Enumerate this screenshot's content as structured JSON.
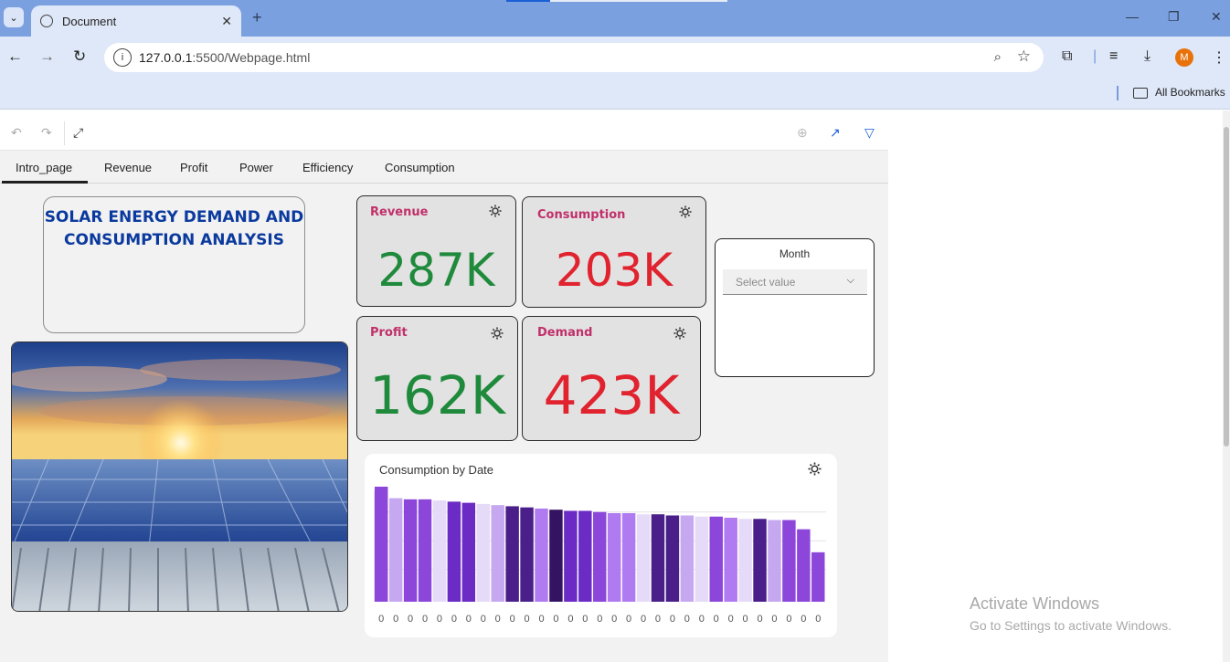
{
  "browser": {
    "tab_title": "Document",
    "url_host": "127.0.0.1",
    "url_rest": ":5500/Webpage.html",
    "bookmarks_label": "All Bookmarks",
    "avatar_initial": "M"
  },
  "report": {
    "tabs": [
      "Intro_page",
      "Revenue",
      "Profit",
      "Power",
      "Efficiency",
      "Consumption"
    ],
    "active_tab": "Intro_page",
    "title_line1": "SOLAR ENERGY DEMAND AND",
    "title_line2": "CONSUMPTION  ANALYSIS"
  },
  "kpis": {
    "revenue": {
      "label": "Revenue",
      "value": "287K",
      "color": "#1f8a3c"
    },
    "consumption": {
      "label": "Consumption",
      "value": "203K",
      "color": "#e0232e"
    },
    "profit": {
      "label": "Profit",
      "value": "162K",
      "color": "#1f8a3c"
    },
    "demand": {
      "label": "Demand",
      "value": "423K",
      "color": "#e0232e"
    }
  },
  "slicer": {
    "title": "Month",
    "placeholder": "Select value"
  },
  "chart_data": {
    "type": "bar",
    "title": "Consumption  by Date",
    "tick_label": "0",
    "values": [
      100,
      90,
      89,
      89,
      88,
      87,
      86,
      85,
      84,
      83,
      82,
      81,
      80,
      79,
      79,
      78,
      77,
      77,
      76,
      76,
      75,
      75,
      74,
      74,
      73,
      72,
      72,
      71,
      71,
      63,
      43
    ],
    "ylim": [
      0,
      100
    ],
    "colors": [
      "#8c46d9",
      "#c6a8f0",
      "#8c46d9",
      "#8c46d9",
      "#e5daf7",
      "#6b2bc4",
      "#6b2bc4",
      "#e5daf7",
      "#c6a8f0",
      "#4a1f8a",
      "#4a1f8a",
      "#b07af0",
      "#341462",
      "#6b2bc4",
      "#6b2bc4",
      "#8c46d9",
      "#b07af0",
      "#b07af0",
      "#e5daf7",
      "#4a1f8a",
      "#4a1f8a",
      "#c6a8f0",
      "#e5daf7",
      "#8c46d9",
      "#b07af0",
      "#e5daf7",
      "#4a1f8a",
      "#c6a8f0",
      "#8c46d9",
      "#8c46d9",
      "#8c46d9"
    ]
  },
  "watermark": {
    "line1": "Activate Windows",
    "line2": "Go to Settings to activate Windows."
  }
}
